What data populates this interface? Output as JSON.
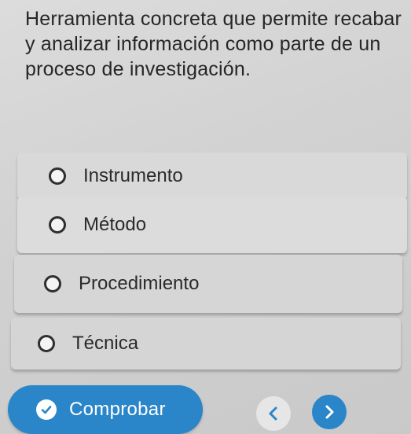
{
  "question": {
    "text": "Herramienta concreta que permite recabar y analizar información como parte de un proceso de investigación."
  },
  "options": [
    {
      "label": "Instrumento"
    },
    {
      "label": "Método"
    },
    {
      "label": "Procedimiento"
    },
    {
      "label": "Técnica"
    }
  ],
  "actions": {
    "check_label": "Comprobar",
    "check_icon": "check-circle-icon",
    "prev_icon": "chevron-left-icon",
    "next_icon": "chevron-right-icon"
  },
  "colors": {
    "accent": "#2a86c8",
    "option_bg": "#d9d9d9",
    "text": "#2b2b2b"
  }
}
